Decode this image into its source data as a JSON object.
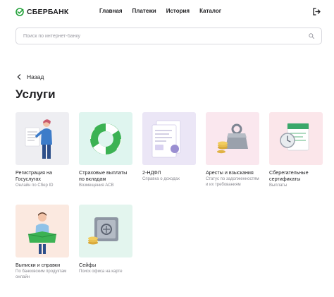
{
  "header": {
    "logo_text": "СБЕРБАНК",
    "brand_color": "#21a038",
    "nav": [
      "Главная",
      "Платежи",
      "История",
      "Каталог"
    ]
  },
  "search": {
    "placeholder": "Поиск по интернет-банку"
  },
  "back": {
    "label": "Назад"
  },
  "page": {
    "title": "Услуги"
  },
  "services": [
    {
      "title": "Регистрация на Госуслугах",
      "subtitle": "Онлайн по Сбер ID",
      "bg": "#eeeef2",
      "icon": "person-document-illustration"
    },
    {
      "title": "Страховые выплаты по вкладам",
      "subtitle": "Возмещения АСВ",
      "bg": "#dff5ef",
      "icon": "lifebuoy-illustration"
    },
    {
      "title": "2-НДФЛ",
      "subtitle": "Справка о доходах",
      "bg": "#ebe6f6",
      "icon": "tax-document-illustration"
    },
    {
      "title": "Аресты и взыскания",
      "subtitle": "Статус по задолженностям и их требованиям",
      "bg": "#fae7ee",
      "icon": "weight-coins-illustration"
    },
    {
      "title": "Сберегательные сертификаты",
      "subtitle": "Выплаты",
      "bg": "#fbe6ea",
      "icon": "certificate-clock-illustration"
    },
    {
      "title": "Выписки и справки",
      "subtitle": "По банковским продуктам онлайн",
      "bg": "#fbe9e0",
      "icon": "person-folder-illustration"
    },
    {
      "title": "Сейфы",
      "subtitle": "Поиск офиса на карте",
      "bg": "#e3f5ee",
      "icon": "safe-coins-illustration"
    }
  ]
}
